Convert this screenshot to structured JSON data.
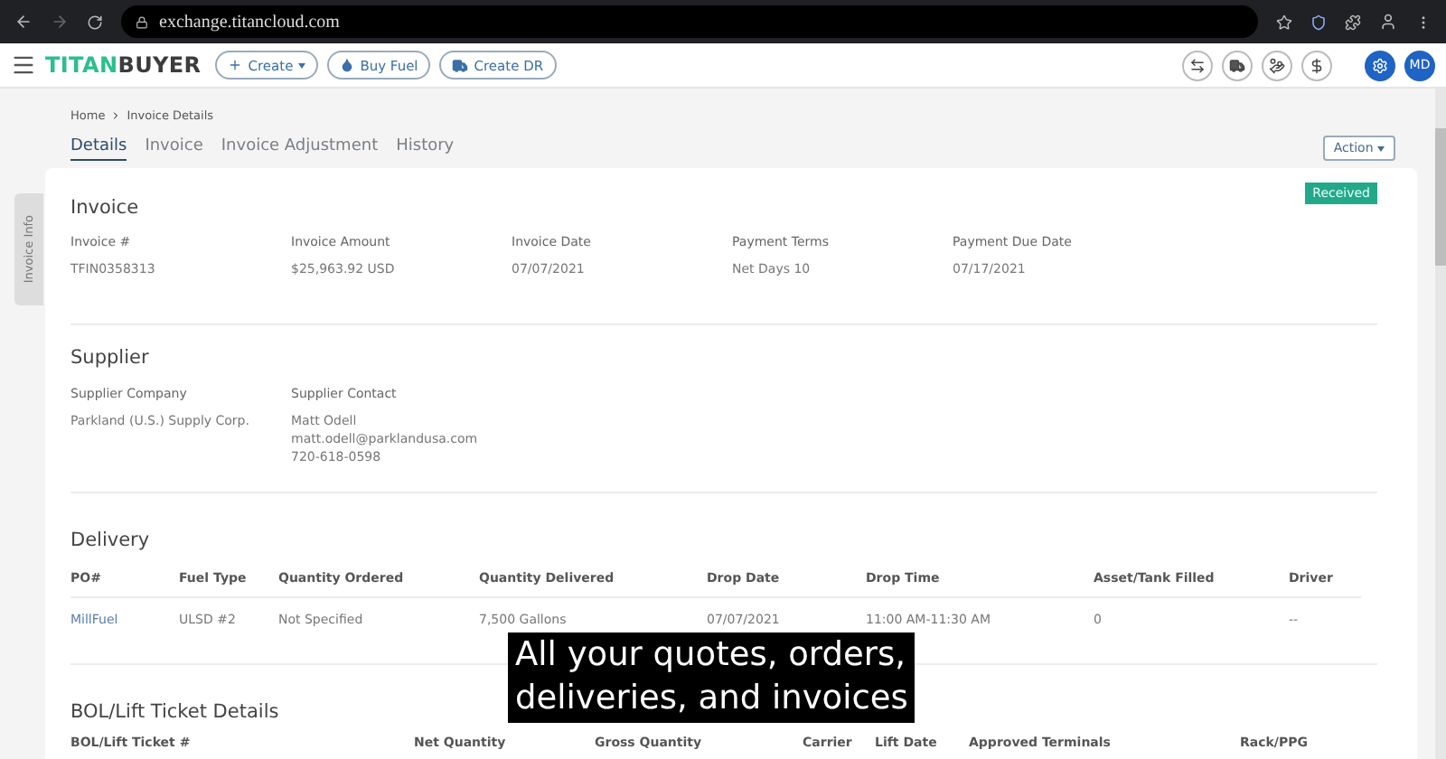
{
  "browser": {
    "url": "exchange.titancloud.com"
  },
  "header": {
    "logo": [
      "TITAN",
      "BUYER"
    ],
    "buttons": [
      {
        "label": "Create",
        "caret": true
      },
      {
        "label": "Buy Fuel",
        "caret": false
      },
      {
        "label": "Create DR",
        "caret": false
      }
    ],
    "avatar": "MD"
  },
  "breadcrumb": [
    "Home",
    "Invoice Details"
  ],
  "tabs": [
    {
      "label": "Details",
      "selected": true
    },
    {
      "label": "Invoice",
      "selected": false
    },
    {
      "label": "Invoice Adjustment",
      "selected": false
    },
    {
      "label": "History",
      "selected": false
    }
  ],
  "action_button": "Action",
  "side_tab": "Invoice Info",
  "invoice": {
    "title": "Invoice",
    "status": "Received",
    "fields": [
      {
        "label": "Invoice #",
        "value": [
          "TFIN0358313"
        ]
      },
      {
        "label": "Invoice Amount",
        "value": [
          "$25,963.92 USD"
        ]
      },
      {
        "label": "Invoice Date",
        "value": [
          "07/07/2021"
        ]
      },
      {
        "label": "Payment Terms",
        "value": [
          "Net Days 10"
        ]
      },
      {
        "label": "Payment Due Date",
        "value": [
          "07/17/2021"
        ]
      }
    ]
  },
  "supplier": {
    "title": "Supplier",
    "fields": [
      {
        "label": "Supplier Company",
        "value": [
          "Parkland (U.S.) Supply Corp."
        ]
      },
      {
        "label": "Supplier Contact",
        "value": [
          "Matt Odell",
          "matt.odell@parklandusa.com",
          "720-618-0598"
        ]
      }
    ]
  },
  "delivery": {
    "title": "Delivery",
    "columns": [
      "PO#",
      "Fuel Type",
      "Quantity Ordered",
      "Quantity Delivered",
      "Drop Date",
      "Drop Time",
      "Asset/Tank Filled",
      "Driver"
    ],
    "rows": [
      [
        {
          "text": "MillFuel",
          "link": true
        },
        {
          "text": "ULSD #2",
          "link": false
        },
        {
          "text": "Not Specified",
          "link": false
        },
        {
          "text": "7,500 Gallons",
          "link": false
        },
        {
          "text": "07/07/2021",
          "link": false
        },
        {
          "text": "11:00 AM-11:30 AM",
          "link": false
        },
        {
          "text": "0",
          "link": false
        },
        {
          "text": "--",
          "link": false
        }
      ]
    ]
  },
  "bol": {
    "title": "BOL/Lift Ticket Details",
    "columns": [
      "BOL/Lift Ticket #",
      "Net Quantity",
      "Gross Quantity",
      "Carrier",
      "Lift Date",
      "Approved Terminals",
      "Rack/PPG"
    ]
  },
  "caption": [
    "All your quotes, orders,",
    "deliveries, and invoices"
  ]
}
